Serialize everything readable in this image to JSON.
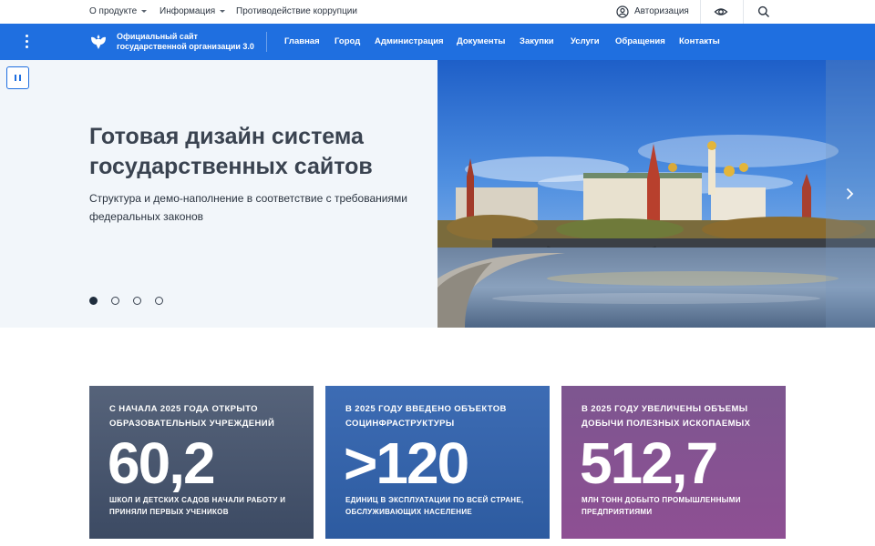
{
  "topbar": {
    "about": "О продукте",
    "info": "Информация",
    "anticorruption": "Противодействие коррупции",
    "auth": "Авторизация"
  },
  "header": {
    "site_name_line1": "Официальный сайт",
    "site_name_line2": "государственной организации 3.0",
    "nav": [
      "Главная",
      "Город",
      "Администрация",
      "Документы",
      "Закупки",
      "Услуги",
      "Обращения",
      "Контакты"
    ]
  },
  "hero": {
    "title_line1": "Готовая дизайн система",
    "title_line2": "государственных сайтов",
    "subtitle_line1": "Структура и демо-наполнение в соответствие с требованиями",
    "subtitle_line2": "федеральных законов",
    "slide_count": 4,
    "active_slide": 1
  },
  "stats": [
    {
      "head": "С начала 2025 года открыто образовательных учреждений",
      "value": "60,2",
      "foot": "школ и детских садов начали работу и приняли первых учеников"
    },
    {
      "head": "В 2025 году введено объектов социнфраструктуры",
      "value": ">120",
      "foot": "единиц в эксплуатации по всей стране, обслуживающих население"
    },
    {
      "head": "В 2025 году увеличены объемы добычи полезных ископаемых",
      "value": "512,7",
      "foot": "млн тонн добыто промышленными предприятиями"
    }
  ],
  "colors": {
    "accent": "#1f6fe0",
    "card1": "#4a576e",
    "card2": "#3563aa",
    "card3": "#864f92"
  }
}
